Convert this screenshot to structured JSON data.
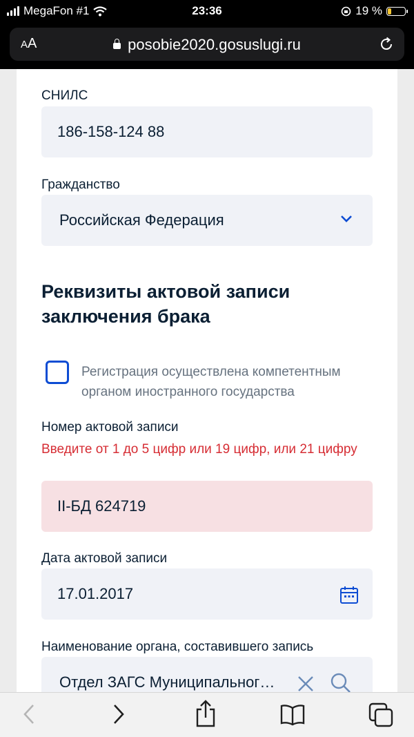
{
  "status_bar": {
    "carrier": "MegaFon #1",
    "time": "23:36",
    "battery": "19 %",
    "battery_level": 0.19
  },
  "browser": {
    "text_size_label": "AA",
    "url": "posobie2020.gosuslugi.ru"
  },
  "form": {
    "snils": {
      "label": "СНИЛС",
      "value": "186-158-124 88"
    },
    "citizenship": {
      "label": "Гражданство",
      "value": "Российская Федерация"
    },
    "section_title": "Реквизиты актовой записи заключения брака",
    "foreign_registration": {
      "label": "Регистрация осуществлена компетентным органом иностранного государства",
      "checked": false
    },
    "record_number": {
      "label": "Номер актовой записи",
      "error": "Введите от 1 до 5 цифр или 19 цифр, или 21 цифру",
      "value": "II-БД 624719"
    },
    "record_date": {
      "label": "Дата актовой записи",
      "value": "17.01.2017"
    },
    "authority": {
      "label": "Наименование органа, составившего запись",
      "value": "Отдел ЗАГС Муниципальног…"
    }
  },
  "colors": {
    "accent": "#0d4cd3",
    "error_text": "#d62d34",
    "error_bg": "#f7e0e3",
    "field_bg": "#f0f2f7"
  }
}
